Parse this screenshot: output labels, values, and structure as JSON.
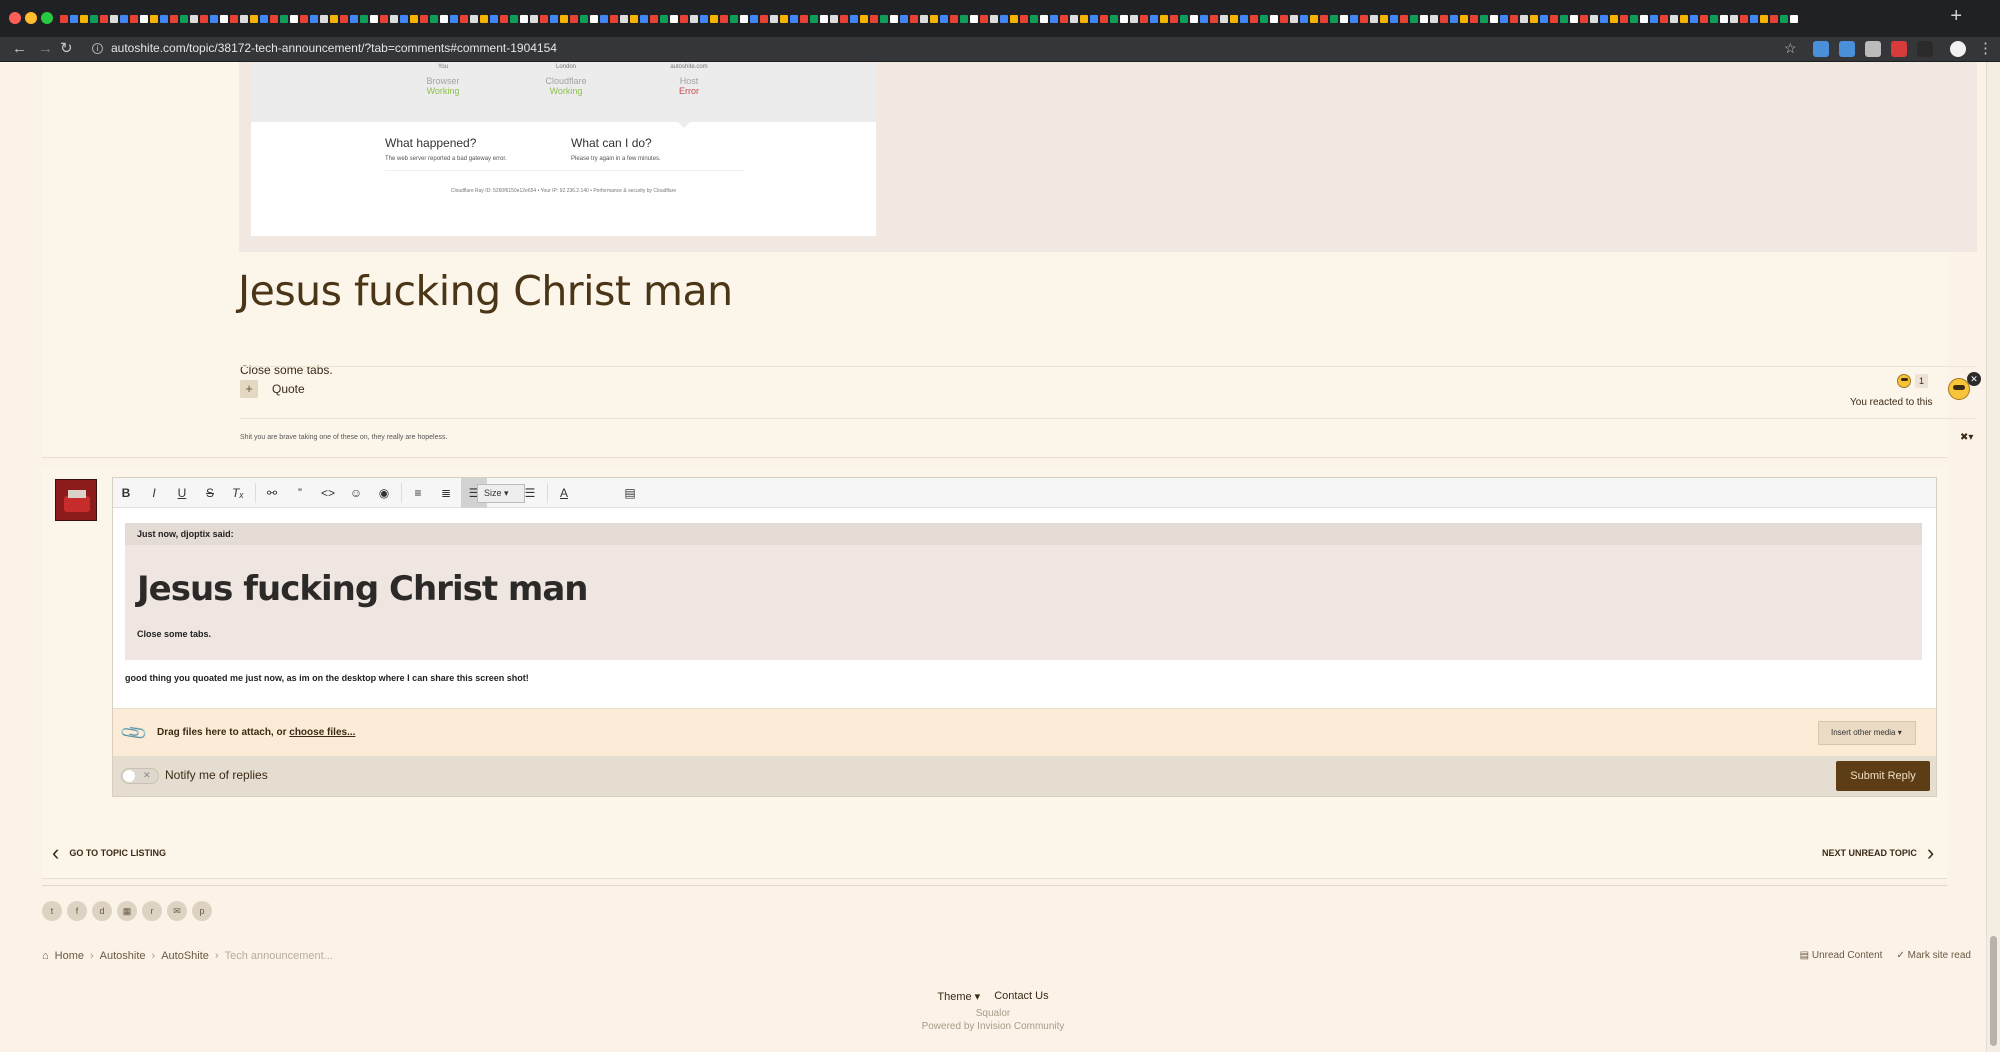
{
  "browser": {
    "url": "autoshite.com/topic/38172-tech-announcement/?tab=comments#comment-1904154",
    "tab_colors": [
      "#e94235",
      "#4285f4",
      "#f4b400",
      "#0f9d58",
      "#e94235",
      "#dddddd",
      "#4285f4",
      "#e94235",
      "#ffffff",
      "#f4b400",
      "#4285f4",
      "#e94235",
      "#0f9d58",
      "#dddddd",
      "#e94235",
      "#4285f4",
      "#ffffff",
      "#e94235",
      "#dddddd",
      "#f4b400",
      "#4285f4",
      "#e94235",
      "#0f9d58",
      "#ffffff",
      "#e94235",
      "#4285f4",
      "#dddddd",
      "#f4b400",
      "#e94235",
      "#4285f4",
      "#0f9d58",
      "#ffffff",
      "#e94235",
      "#dddddd",
      "#4285f4",
      "#f4b400",
      "#e94235",
      "#0f9d58",
      "#ffffff",
      "#4285f4",
      "#e94235",
      "#dddddd",
      "#f4b400",
      "#4285f4",
      "#e94235",
      "#0f9d58",
      "#ffffff",
      "#dddddd",
      "#e94235",
      "#4285f4",
      "#f4b400",
      "#e94235",
      "#0f9d58",
      "#ffffff",
      "#4285f4",
      "#e94235",
      "#dddddd",
      "#f4b400",
      "#4285f4",
      "#e94235",
      "#0f9d58",
      "#ffffff",
      "#e94235",
      "#dddddd",
      "#4285f4",
      "#f4b400",
      "#e94235",
      "#0f9d58",
      "#ffffff",
      "#4285f4",
      "#e94235",
      "#dddddd",
      "#f4b400",
      "#4285f4",
      "#e94235",
      "#0f9d58",
      "#ffffff",
      "#dddddd",
      "#e94235",
      "#4285f4",
      "#f4b400",
      "#e94235",
      "#0f9d58",
      "#ffffff",
      "#4285f4",
      "#e94235",
      "#dddddd",
      "#f4b400",
      "#4285f4",
      "#e94235",
      "#0f9d58",
      "#ffffff",
      "#e94235",
      "#dddddd",
      "#4285f4",
      "#f4b400",
      "#e94235",
      "#0f9d58",
      "#ffffff",
      "#4285f4",
      "#e94235",
      "#dddddd",
      "#f4b400",
      "#4285f4",
      "#e94235",
      "#0f9d58",
      "#ffffff",
      "#dddddd",
      "#e94235",
      "#4285f4",
      "#f4b400",
      "#e94235",
      "#0f9d58",
      "#ffffff",
      "#4285f4",
      "#e94235",
      "#dddddd",
      "#f4b400",
      "#4285f4",
      "#e94235",
      "#0f9d58",
      "#ffffff",
      "#e94235",
      "#dddddd",
      "#4285f4",
      "#f4b400",
      "#e94235",
      "#0f9d58",
      "#ffffff",
      "#4285f4",
      "#e94235",
      "#dddddd",
      "#f4b400",
      "#4285f4",
      "#e94235",
      "#0f9d58",
      "#ffffff",
      "#dddddd",
      "#e94235",
      "#4285f4",
      "#f4b400",
      "#e94235",
      "#0f9d58",
      "#ffffff",
      "#4285f4",
      "#e94235",
      "#dddddd",
      "#f4b400",
      "#4285f4",
      "#e94235",
      "#0f9d58",
      "#ffffff",
      "#e94235",
      "#dddddd",
      "#4285f4",
      "#f4b400",
      "#e94235",
      "#0f9d58",
      "#ffffff",
      "#4285f4",
      "#e94235",
      "#dddddd",
      "#f4b400",
      "#4285f4",
      "#e94235",
      "#0f9d58",
      "#ffffff",
      "#dddddd",
      "#e94235",
      "#4285f4",
      "#f4b400",
      "#e94235",
      "#0f9d58",
      "#ffffff"
    ],
    "extension_colors": [
      "#4a90d9",
      "#4a90d9",
      "#bbbbbb",
      "#d83b3b",
      "#2b2b2b"
    ],
    "new_tab_glyph": "+"
  },
  "cloudflare_screenshot": {
    "columns": [
      {
        "role": "You",
        "name": "Browser",
        "status": "Working",
        "status_type": "ok"
      },
      {
        "role": "London",
        "name": "Cloudflare",
        "status": "Working",
        "status_type": "ok"
      },
      {
        "role": "autoshite.com",
        "name": "Host",
        "status": "Error",
        "status_type": "error"
      }
    ],
    "what_happened_title": "What happened?",
    "what_happened_text": "The web server reported a bad gateway error.",
    "what_can_i_do_title": "What can I do?",
    "what_can_i_do_text": "Please try again in a few minutes.",
    "footer": "Cloudflare Ray ID: 5260f6150e12e654 • Your IP: 92.236.2.140 • Performance & security by Cloudflare"
  },
  "post": {
    "title": "Jesus fucking Christ man",
    "body": "Close some tabs.",
    "quote_label": "Quote",
    "reaction_count": "1",
    "reaction_note": "You reacted to this",
    "signature": "Shit you are brave taking one of these on, they really are hopeless."
  },
  "editor": {
    "size_label": "Size",
    "quote_header": "Just now, djoptix said:",
    "quote_title": "Jesus fucking Christ man",
    "quote_body": "Close some tabs.",
    "reply_text": "good thing you quoated me just now, as im on the desktop where I can share this screen shot!",
    "attach_prefix": "Drag files here to attach, or ",
    "attach_link": "choose files...",
    "insert_media": "Insert other media",
    "notify_label": "Notify me of replies",
    "submit_label": "Submit Reply"
  },
  "pager": {
    "prev_label": "GO TO TOPIC LISTING",
    "next_label": "NEXT UNREAD TOPIC"
  },
  "footer": {
    "breadcrumbs": [
      "Home",
      "Autoshite",
      "AutoShite",
      "Tech announcement..."
    ],
    "unread_content": "Unread Content",
    "mark_site_read": "Mark site read",
    "theme_label": "Theme",
    "contact_label": "Contact Us",
    "theme_name": "Squalor",
    "powered_by": "Powered by Invision Community"
  }
}
